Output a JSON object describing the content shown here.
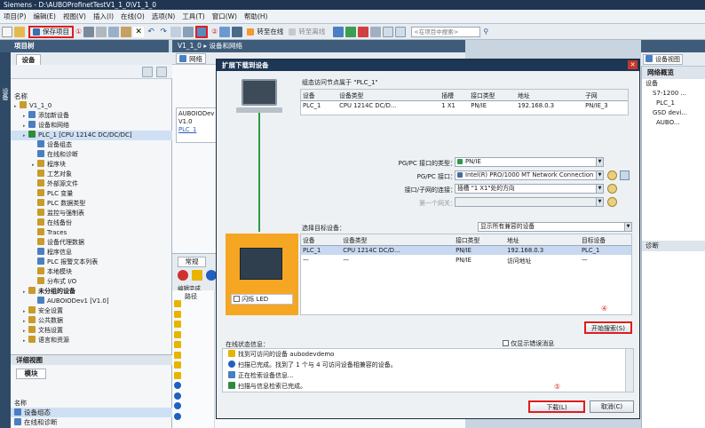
{
  "app": {
    "title": "Siemens - D:\\AUBOProfinetTestV1_1_0\\V1_1_0"
  },
  "menu": [
    "项目(P)",
    "编辑(E)",
    "视图(V)",
    "插入(I)",
    "在线(O)",
    "选项(N)",
    "工具(T)",
    "窗口(W)",
    "帮助(H)"
  ],
  "toolbar": {
    "save_label": "保存项目",
    "annot1": "①",
    "annot2": "②",
    "go_online": "转至在线",
    "go_offline": "转至离线",
    "search_placeholder": "<在项目中搜索>"
  },
  "left": {
    "header": "项目树",
    "tab_devices": "设备",
    "name_col": "名称",
    "sidetab": "设备",
    "tree": [
      {
        "label": "V1_1_0",
        "indent": 0,
        "color": "#c89b2a"
      },
      {
        "label": "添加新设备",
        "indent": 1,
        "color": "#4a7fc1"
      },
      {
        "label": "设备和网络",
        "indent": 1,
        "color": "#4a7fc1"
      },
      {
        "label": "PLC_1 [CPU 1214C DC/DC/DC]",
        "indent": 1,
        "color": "#2e8b3e",
        "selected": true
      },
      {
        "label": "设备组态",
        "indent": 2,
        "color": "#4a7fc1"
      },
      {
        "label": "在线和诊断",
        "indent": 2,
        "color": "#4a7fc1"
      },
      {
        "label": "程序块",
        "indent": 2,
        "color": "#c89b2a"
      },
      {
        "label": "工艺对象",
        "indent": 2,
        "color": "#c89b2a"
      },
      {
        "label": "外部源文件",
        "indent": 2,
        "color": "#c89b2a"
      },
      {
        "label": "PLC 变量",
        "indent": 2,
        "color": "#c89b2a"
      },
      {
        "label": "PLC 数据类型",
        "indent": 2,
        "color": "#c89b2a"
      },
      {
        "label": "监控与强制表",
        "indent": 2,
        "color": "#c89b2a"
      },
      {
        "label": "在线备份",
        "indent": 2,
        "color": "#c89b2a"
      },
      {
        "label": "Traces",
        "indent": 2,
        "color": "#c89b2a"
      },
      {
        "label": "设备代理数据",
        "indent": 2,
        "color": "#c89b2a"
      },
      {
        "label": "程序信息",
        "indent": 2,
        "color": "#4a7fc1"
      },
      {
        "label": "PLC 报警文本列表",
        "indent": 2,
        "color": "#4a7fc1"
      },
      {
        "label": "本地模块",
        "indent": 2,
        "color": "#c89b2a"
      },
      {
        "label": "分布式 I/O",
        "indent": 2,
        "color": "#c89b2a"
      },
      {
        "label": "未分组的设备",
        "indent": 1,
        "color": "#c89b2a",
        "bold": true
      },
      {
        "label": "AUBOIODev1 [V1.0]",
        "indent": 2,
        "color": "#4a7fc1"
      },
      {
        "label": "安全设置",
        "indent": 1,
        "color": "#c89b2a"
      },
      {
        "label": "公共数据",
        "indent": 1,
        "color": "#c89b2a"
      },
      {
        "label": "文档设置",
        "indent": 1,
        "color": "#c89b2a"
      },
      {
        "label": "语言和资源",
        "indent": 1,
        "color": "#c89b2a"
      }
    ],
    "detail_header": "详细视图",
    "detail_tab": "模块",
    "detail_name_col": "名称",
    "detail_rows": [
      "设备组态",
      "在线和诊断"
    ]
  },
  "work": {
    "tab_title": "V1_1_0 ▸ 设备和网络",
    "network_btn": "网络",
    "device_name": "AUBOIODev",
    "device_ver": "V1.0",
    "plc_link": "PLC_1",
    "insp_tab": "常规",
    "insp_cols": [
      "编辑完成",
      "路径"
    ],
    "insp_diag": "诊断"
  },
  "right": {
    "header": "设备视图",
    "overview": "网络概览",
    "rows": [
      "设备",
      "S7-1200 ...",
      "PLC_1",
      "GSD devi...",
      "AUBO..."
    ]
  },
  "dialog": {
    "title": "扩展下载到设备",
    "nodes_caption": "组态访问节点属于 \"PLC_1\"",
    "nodes_headers": [
      "设备",
      "设备类型",
      "插槽",
      "接口类型",
      "地址",
      "子网"
    ],
    "nodes_row": [
      "PLC_1",
      "CPU 1214C DC/D...",
      "1 X1",
      "PN/IE",
      "192.168.0.3",
      "PN/IE_3"
    ],
    "pg_type_label": "PG/PC 接口的类型：",
    "pg_type_value": "PN/IE",
    "pg_if_label": "PG/PC 接口：",
    "pg_if_value": "Intel(R) PRO/1000 MT Network Connection",
    "subnet_label": "接口/子网的连接：",
    "subnet_value": "插槽 \"1 X1\"处的方向",
    "gateway_label": "第一个网关：",
    "gateway_value": "",
    "target_caption": "选择目标设备：",
    "filter_value": "显示所有兼容的设备",
    "target_headers": [
      "设备",
      "设备类型",
      "接口类型",
      "地址",
      "目标设备"
    ],
    "target_rows": [
      [
        "PLC_1",
        "CPU 1214C DC/D...",
        "PN/IE",
        "192.168.0.3",
        "PLC_1"
      ],
      [
        "—",
        "—",
        "PN/IE",
        "访问地址",
        "—"
      ]
    ],
    "flash_label": "闪烁 LED",
    "start_search": "开始搜索(S)",
    "annot4": "④",
    "annot5": "⑤",
    "status_caption": "在线状态信息：",
    "show_errors": "仅显示错误消息",
    "status_rows": [
      {
        "text": "找到可访问的设备 aubodevdemo",
        "icon": "warning",
        "color": "#e8b400"
      },
      {
        "text": "扫描已完成。找到了 1 个与 4 可访问设备相兼容的设备。",
        "icon": "info",
        "color": "#2060c0"
      },
      {
        "text": "正在检索设备信息...",
        "icon": "progress",
        "color": "#4a7fc1"
      },
      {
        "text": "扫描与信息检索已完成。",
        "icon": "check",
        "color": "#2e8b3e"
      }
    ],
    "download_btn": "下载(L)",
    "cancel_btn": "取消(C)"
  }
}
